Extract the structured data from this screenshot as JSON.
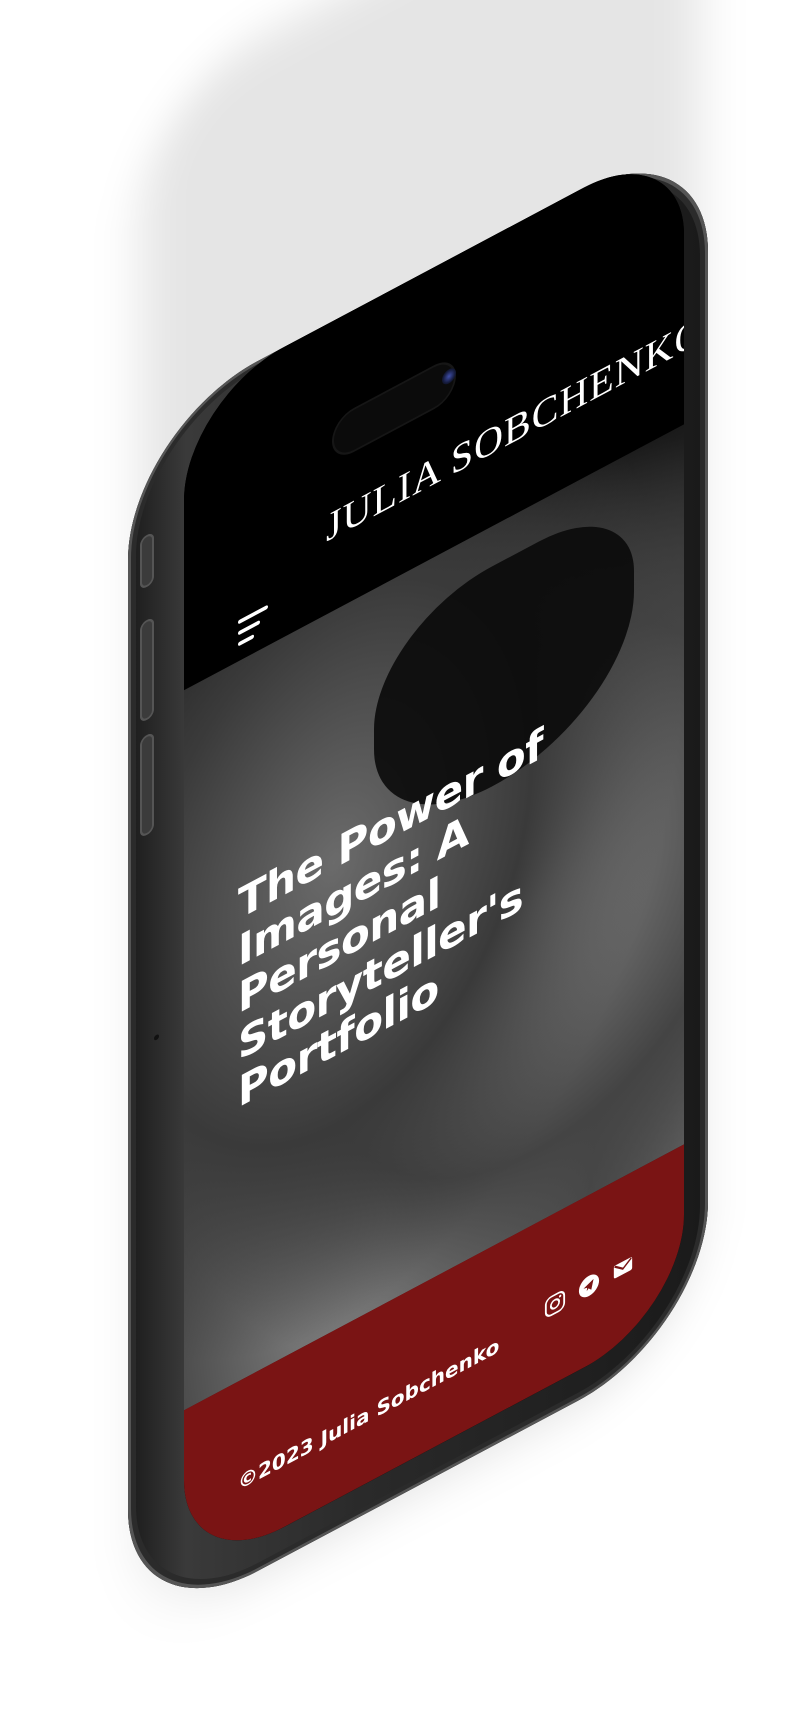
{
  "header": {
    "brand": "JULIA SOBCHENKO",
    "menu_icon": "hamburger-menu-icon"
  },
  "hero": {
    "title": "The Power of Images: A Personal Storyteller's Portfolio"
  },
  "footer": {
    "copyright": "©2023 Julia Sobchenko",
    "social_icons": [
      "instagram-icon",
      "telegram-icon",
      "mail-icon"
    ]
  },
  "colors": {
    "header_bg": "#000000",
    "footer_bg": "#7a1414",
    "text": "#ffffff"
  }
}
